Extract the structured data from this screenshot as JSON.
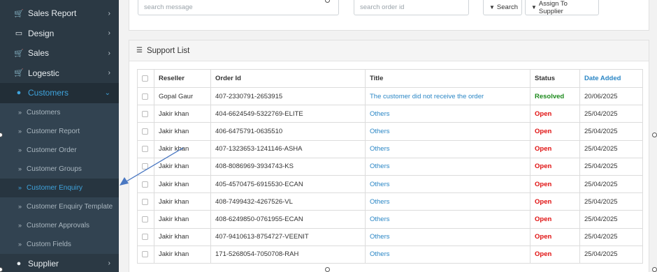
{
  "sidebar": {
    "items": [
      {
        "label": "Sales Report",
        "icon": "cart-icon"
      },
      {
        "label": "Design",
        "icon": "monitor-icon"
      },
      {
        "label": "Sales",
        "icon": "cart-icon"
      },
      {
        "label": "Logestic",
        "icon": "cart-icon"
      },
      {
        "label": "Customers",
        "icon": "user-icon"
      }
    ],
    "sub_items": [
      "Customers",
      "Customer Report",
      "Customer Order",
      "Customer Groups",
      "Customer Enquiry",
      "Customer Enquiry Template",
      "Customer Approvals",
      "Custom Fields"
    ],
    "last_item": {
      "label": "Supplier",
      "icon": "user-icon"
    }
  },
  "filters": {
    "message_placeholder": "search message",
    "order_placeholder": "search order id",
    "search_label": "Search",
    "assign_label": "Assign To Supplier"
  },
  "panel": {
    "title": "Support List"
  },
  "table": {
    "headers": [
      "Reseller",
      "Order Id",
      "Title",
      "Status",
      "Date Added"
    ],
    "rows": [
      {
        "reseller": "Gopal Gaur",
        "order_id": "407-2330791-2653915",
        "title": "The customer did not receive the order",
        "status": "Resolved",
        "date": "20/06/2025"
      },
      {
        "reseller": "Jakir khan",
        "order_id": "404-6624549-5322769-ELITE",
        "title": "Others",
        "status": "Open",
        "date": "25/04/2025"
      },
      {
        "reseller": "Jakir khan",
        "order_id": "406-6475791-0635510",
        "title": "Others",
        "status": "Open",
        "date": "25/04/2025"
      },
      {
        "reseller": "Jakir khan",
        "order_id": "407-1323653-1241146-ASHA",
        "title": "Others",
        "status": "Open",
        "date": "25/04/2025"
      },
      {
        "reseller": "Jakir khan",
        "order_id": "408-8086969-3934743-KS",
        "title": "Others",
        "status": "Open",
        "date": "25/04/2025"
      },
      {
        "reseller": "Jakir khan",
        "order_id": "405-4570475-6915530-ECAN",
        "title": "Others",
        "status": "Open",
        "date": "25/04/2025"
      },
      {
        "reseller": "Jakir khan",
        "order_id": "408-7499432-4267526-VL",
        "title": "Others",
        "status": "Open",
        "date": "25/04/2025"
      },
      {
        "reseller": "Jakir khan",
        "order_id": "408-6249850-0761955-ECAN",
        "title": "Others",
        "status": "Open",
        "date": "25/04/2025"
      },
      {
        "reseller": "Jakir khan",
        "order_id": "407-9410613-8754727-VEENIT",
        "title": "Others",
        "status": "Open",
        "date": "25/04/2025"
      },
      {
        "reseller": "Jakir khan",
        "order_id": "171-5268054-7050708-RAH",
        "title": "Others",
        "status": "Open",
        "date": "25/04/2025"
      }
    ]
  },
  "colors": {
    "sidebar_bg": "#2b3944",
    "accent": "#3fa4dd",
    "link": "#2a86c5",
    "open": "#e01010",
    "resolved": "#1c8a1c",
    "annotation_arrow": "#4a78c2"
  }
}
